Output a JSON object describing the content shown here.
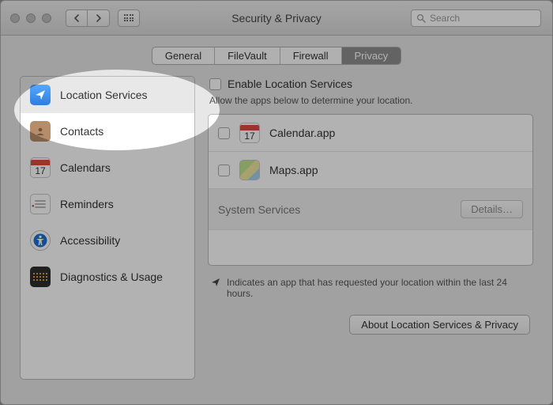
{
  "window": {
    "title": "Security & Privacy"
  },
  "search": {
    "placeholder": "Search"
  },
  "tabs": [
    {
      "label": "General"
    },
    {
      "label": "FileVault"
    },
    {
      "label": "Firewall"
    },
    {
      "label": "Privacy"
    }
  ],
  "sidebar": [
    {
      "label": "Location Services"
    },
    {
      "label": "Contacts"
    },
    {
      "label": "Calendars"
    },
    {
      "label": "Reminders"
    },
    {
      "label": "Accessibility"
    },
    {
      "label": "Diagnostics & Usage"
    }
  ],
  "content": {
    "enable_label": "Enable Location Services",
    "subtext": "Allow the apps below to determine your location.",
    "apps": [
      {
        "name": "Calendar.app",
        "day": "17"
      },
      {
        "name": "Maps.app"
      }
    ],
    "system_services_label": "System Services",
    "details_label": "Details…",
    "note": "Indicates an app that has requested your location within the last 24 hours.",
    "about_button": "About Location Services & Privacy"
  }
}
